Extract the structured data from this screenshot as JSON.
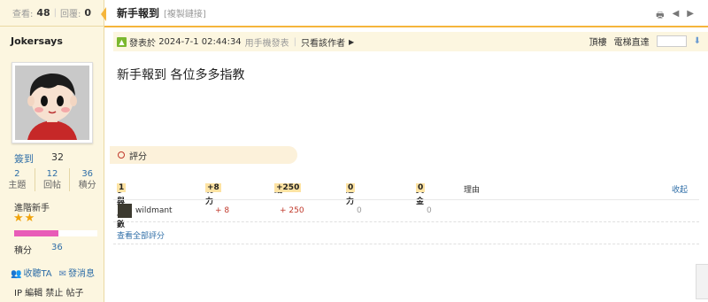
{
  "stats": {
    "views_label": "查看:",
    "views": "48",
    "replies_label": "回覆:",
    "replies": "0"
  },
  "user": {
    "name": "Jokersays",
    "signin_label": "簽到",
    "signin_value": "32",
    "counts": [
      {
        "num": "2",
        "label": "主題"
      },
      {
        "num": "12",
        "label": "回帖"
      },
      {
        "num": "36",
        "label": "積分"
      }
    ],
    "rank": "進階新手",
    "stars": "★★",
    "progress_fraction": 0.53,
    "progress_color": "#e85cb8",
    "points_label": "積分",
    "points_value": "36",
    "follow_label": "收聽TA",
    "message_label": "發消息",
    "admin_links": [
      "IP",
      "編輯",
      "禁止",
      "帖子"
    ]
  },
  "thread": {
    "title": "新手報到",
    "copy_link": "[複製鏈接]",
    "tool_icons": [
      "print-icon",
      "prev-icon",
      "next-icon"
    ]
  },
  "post": {
    "posted_label": "發表於",
    "posted_time": "2024-7-1 02:44:34",
    "mobile_label": "用手機發表",
    "only_author_label": "只看該作者",
    "floor_label": "頂樓",
    "elevator_label": "電梯直達",
    "content": "新手報到 各位多多指教"
  },
  "rating": {
    "title": "評分",
    "headers": {
      "participants": "參與人數",
      "participants_count": "1",
      "c1": "魄力",
      "c1_total": "+8",
      "c2": "錢",
      "c2_total": "+250",
      "c3": "魅力",
      "c3_total": "0",
      "c4": "黃金",
      "c4_total": "0",
      "reason": "理由",
      "collapse": "收起"
    },
    "rows": [
      {
        "user": "wildmant",
        "v1": "+ 8",
        "v2": "+ 250",
        "v3": "0",
        "v4": "0"
      }
    ],
    "view_all": "查看全部評分"
  }
}
